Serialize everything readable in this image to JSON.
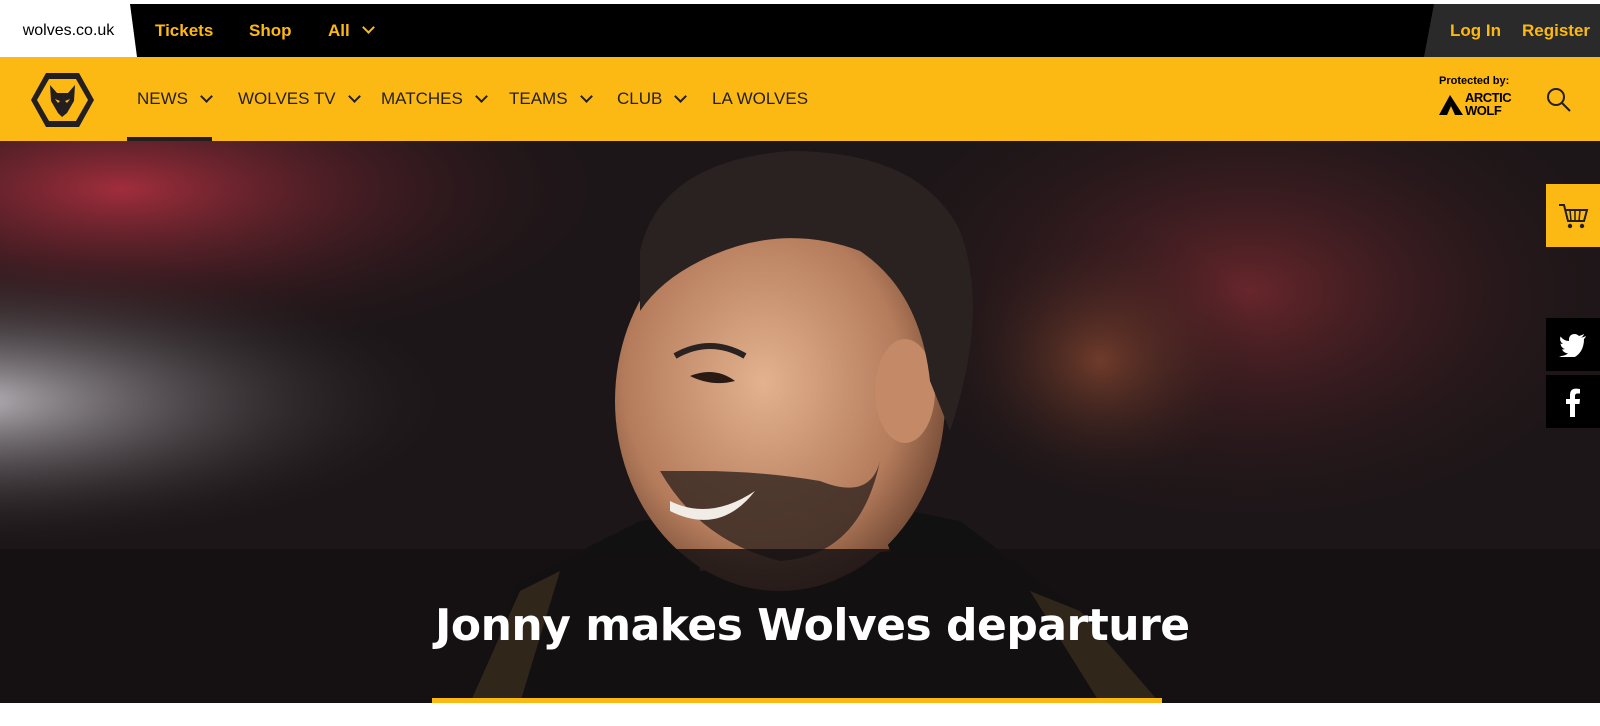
{
  "topbar": {
    "site_name": "wolves.co.uk",
    "links": [
      "Tickets",
      "Shop",
      "All"
    ],
    "login": "Log In",
    "register": "Register"
  },
  "nav": {
    "items": [
      "NEWS",
      "WOLVES TV",
      "MATCHES",
      "TEAMS",
      "CLUB",
      "LA WOLVES"
    ],
    "active": "NEWS",
    "sponsor_label": "Protected by:",
    "sponsor_name_line1": "ARCTIC",
    "sponsor_name_line2": "WOLF"
  },
  "hero": {
    "headline": "Jonny makes Wolves departure"
  },
  "icons": {
    "crest": "wolves-crest-icon",
    "search": "search-icon",
    "cart": "shopping-cart-icon",
    "twitter": "twitter-icon",
    "facebook": "facebook-icon"
  },
  "colors": {
    "gold": "#fdb913",
    "black": "#000000",
    "dark": "#231f20"
  }
}
